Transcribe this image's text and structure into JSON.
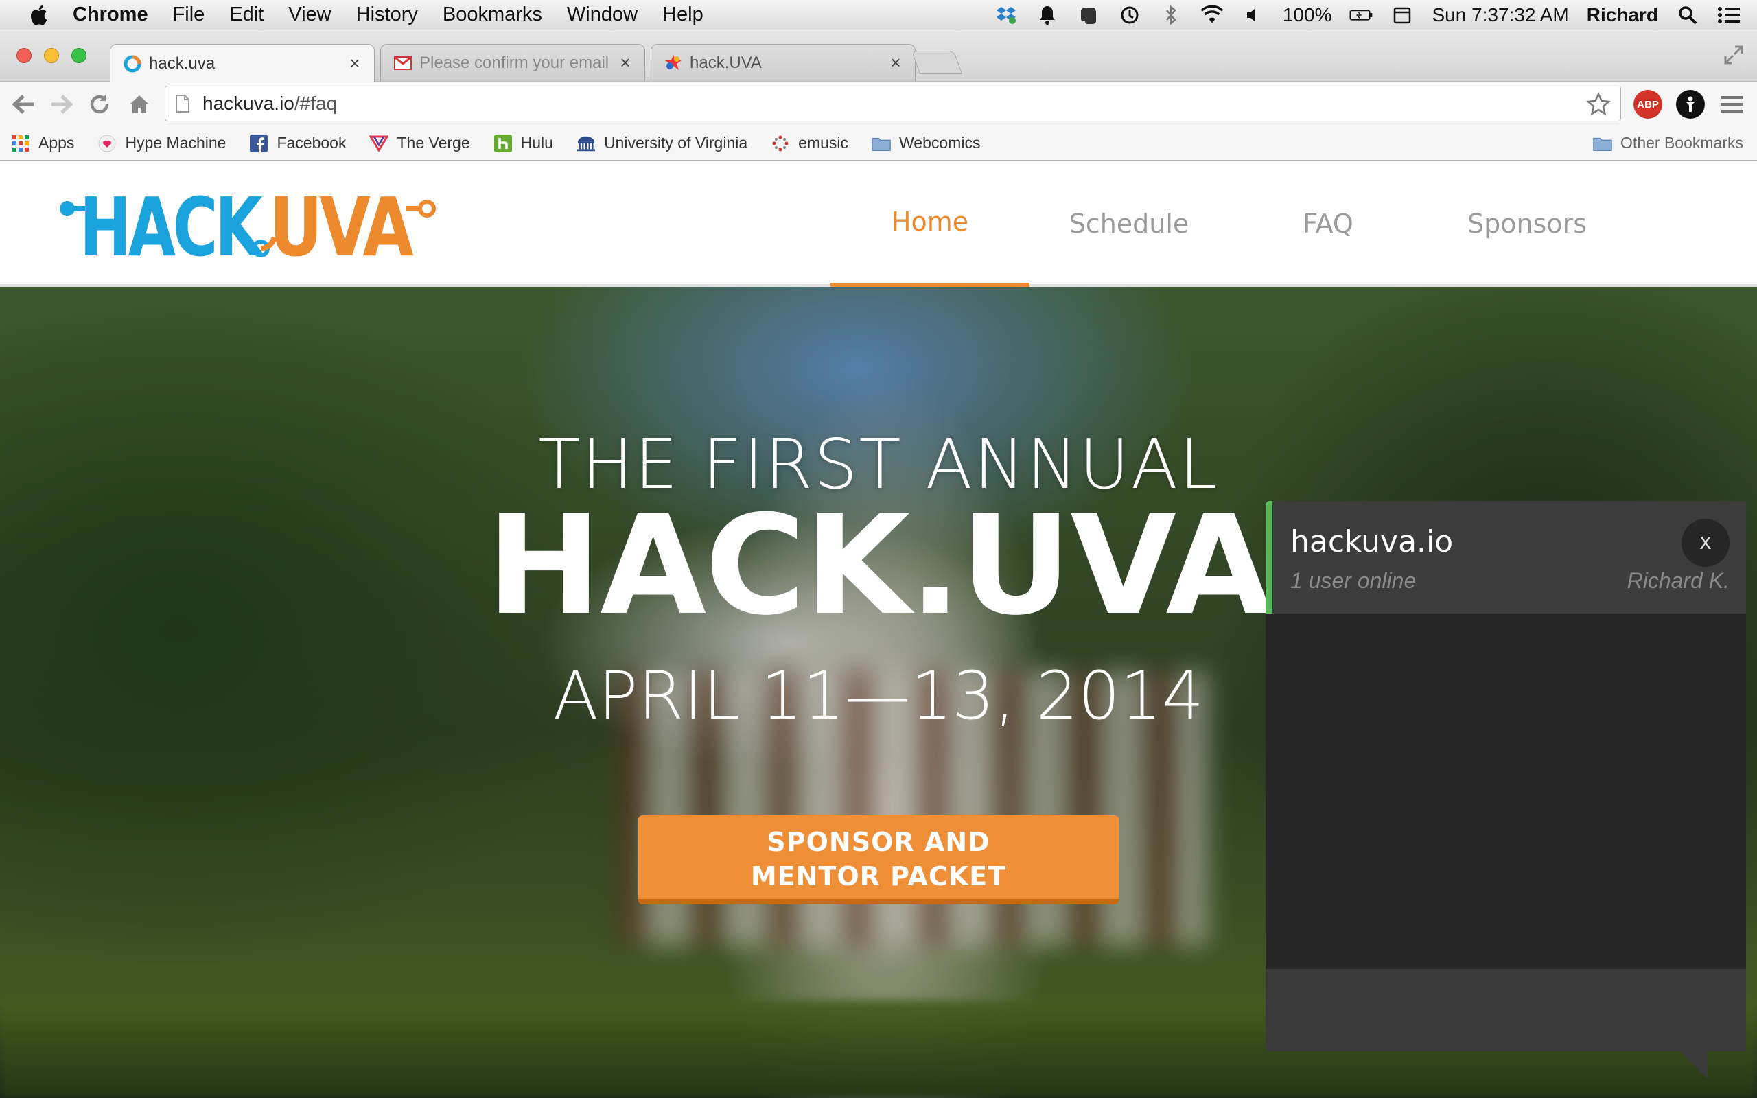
{
  "menubar": {
    "app_name": "Chrome",
    "items": [
      "File",
      "Edit",
      "View",
      "History",
      "Bookmarks",
      "Window",
      "Help"
    ],
    "battery": "100%",
    "clock": "Sun 7:37:32 AM",
    "user": "Richard"
  },
  "tabs": [
    {
      "title": "hack.uva",
      "active": true
    },
    {
      "title": "Please confirm your email",
      "active": false
    },
    {
      "title": "hack.UVA",
      "active": false
    }
  ],
  "omnibox": {
    "host": "hackuva.io",
    "path": "/#faq"
  },
  "bookmarks": {
    "items": [
      "Apps",
      "Hype Machine",
      "Facebook",
      "The Verge",
      "Hulu",
      "University of Virginia",
      "emusic",
      "Webcomics"
    ],
    "other": "Other Bookmarks"
  },
  "site": {
    "logo_text": "HACK.UVA",
    "nav": [
      "Home",
      "Schedule",
      "FAQ",
      "Sponsors"
    ],
    "active_nav": "Home",
    "hero": {
      "pre_title": "THE FIRST ANNUAL",
      "title": "HACK.UVA",
      "date": "APRIL 11—13, 2014",
      "cta_line1": "SPONSOR AND",
      "cta_line2": "MENTOR PACKET"
    }
  },
  "chat": {
    "title": "hackuva.io",
    "users_online": "1 user online",
    "current_user": "Richard K.",
    "close_label": "x"
  },
  "colors": {
    "accent_orange": "#ee8a2e",
    "logo_blue": "#1aa3dd",
    "chat_online_green": "#5cb85c"
  }
}
